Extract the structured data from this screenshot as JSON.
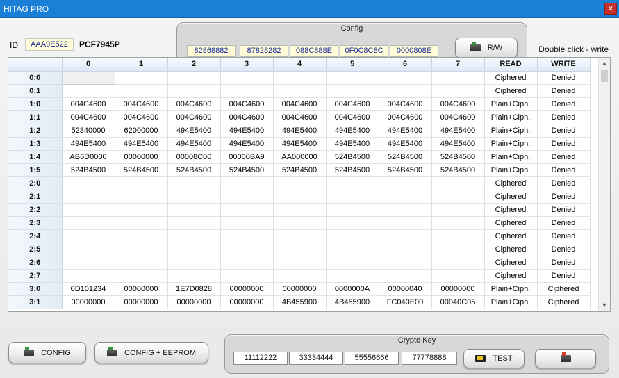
{
  "window": {
    "title": "HITAG PRO",
    "close_label": "x"
  },
  "id": {
    "label": "ID",
    "value": "AAA9E522",
    "chip": "PCF7945P"
  },
  "config": {
    "title": "Config",
    "values": [
      "82868882",
      "87828282",
      "088C888E",
      "0F0C8C8C",
      "0000808E"
    ],
    "rw_label": "R/W"
  },
  "hint": "Double click - write",
  "table": {
    "columns": [
      "",
      "0",
      "1",
      "2",
      "3",
      "4",
      "5",
      "6",
      "7",
      "READ",
      "WRITE"
    ],
    "rows": [
      [
        "0:0",
        "",
        "",
        "",
        "",
        "",
        "",
        "",
        "",
        "Ciphered",
        "Denied"
      ],
      [
        "0:1",
        "",
        "",
        "",
        "",
        "",
        "",
        "",
        "",
        "Ciphered",
        "Denied"
      ],
      [
        "1:0",
        "004C4600",
        "004C4600",
        "004C4600",
        "004C4600",
        "004C4600",
        "004C4600",
        "004C4600",
        "004C4600",
        "Plain+Ciph.",
        "Denied"
      ],
      [
        "1:1",
        "004C4600",
        "004C4600",
        "004C4600",
        "004C4600",
        "004C4600",
        "004C4600",
        "004C4600",
        "004C4600",
        "Plain+Ciph.",
        "Denied"
      ],
      [
        "1:2",
        "52340000",
        "62000000",
        "494E5400",
        "494E5400",
        "494E5400",
        "494E5400",
        "494E5400",
        "494E5400",
        "Plain+Ciph.",
        "Denied"
      ],
      [
        "1:3",
        "494E5400",
        "494E5400",
        "494E5400",
        "494E5400",
        "494E5400",
        "494E5400",
        "494E5400",
        "494E5400",
        "Plain+Ciph.",
        "Denied"
      ],
      [
        "1:4",
        "AB6D0000",
        "00000000",
        "00008C00",
        "00000BA9",
        "AA000000",
        "524B4500",
        "524B4500",
        "524B4500",
        "Plain+Ciph.",
        "Denied"
      ],
      [
        "1:5",
        "524B4500",
        "524B4500",
        "524B4500",
        "524B4500",
        "524B4500",
        "524B4500",
        "524B4500",
        "524B4500",
        "Plain+Ciph.",
        "Denied"
      ],
      [
        "2:0",
        "",
        "",
        "",
        "",
        "",
        "",
        "",
        "",
        "Ciphered",
        "Denied"
      ],
      [
        "2:1",
        "",
        "",
        "",
        "",
        "",
        "",
        "",
        "",
        "Ciphered",
        "Denied"
      ],
      [
        "2:2",
        "",
        "",
        "",
        "",
        "",
        "",
        "",
        "",
        "Ciphered",
        "Denied"
      ],
      [
        "2:3",
        "",
        "",
        "",
        "",
        "",
        "",
        "",
        "",
        "Ciphered",
        "Denied"
      ],
      [
        "2:4",
        "",
        "",
        "",
        "",
        "",
        "",
        "",
        "",
        "Ciphered",
        "Denied"
      ],
      [
        "2:5",
        "",
        "",
        "",
        "",
        "",
        "",
        "",
        "",
        "Ciphered",
        "Denied"
      ],
      [
        "2:6",
        "",
        "",
        "",
        "",
        "",
        "",
        "",
        "",
        "Ciphered",
        "Denied"
      ],
      [
        "2:7",
        "",
        "",
        "",
        "",
        "",
        "",
        "",
        "",
        "Ciphered",
        "Denied"
      ],
      [
        "3:0",
        "0D101234",
        "00000000",
        "1E7D0828",
        "00000000",
        "00000000",
        "0000000A",
        "00000040",
        "00000000",
        "Plain+Ciph.",
        "Ciphered"
      ],
      [
        "3:1",
        "00000000",
        "00000000",
        "00000000",
        "00000000",
        "4B455900",
        "4B455900",
        "FC040E00",
        "00040C05",
        "Plain+Ciph.",
        "Ciphered"
      ]
    ]
  },
  "buttons": {
    "config": "CONFIG",
    "config_eeprom": "CONFIG + EEPROM"
  },
  "crypto": {
    "title": "Crypto Key",
    "values": [
      "11112222",
      "33334444",
      "55556666",
      "77778888"
    ],
    "test_label": "TEST"
  },
  "icons": {
    "close": "close-icon",
    "read_chip": "chip-read-icon",
    "write_chip": "chip-write-icon",
    "test": "flash-icon"
  },
  "colors": {
    "titlebar": "#1a7fd6",
    "field_bg": "#fffbd6",
    "field_text": "#1a2c9c",
    "header_bg": "#dde9f5"
  }
}
